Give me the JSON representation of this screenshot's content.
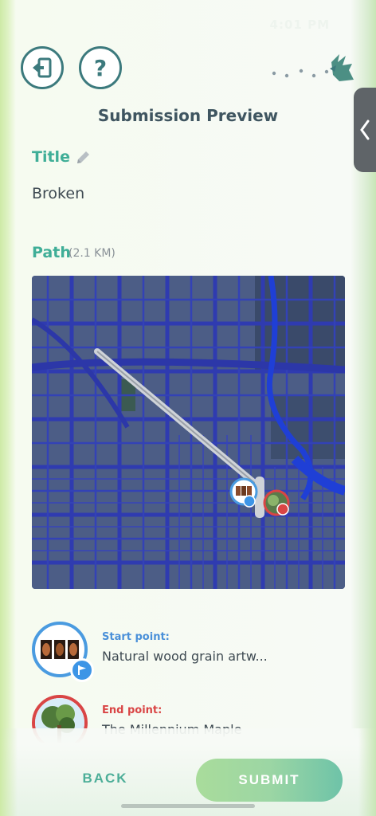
{
  "status": {
    "text": "4:01 PM"
  },
  "header": {
    "title": "Submission Preview"
  },
  "form": {
    "title_label": "Title",
    "title_value": "Broken",
    "path_label": "Path",
    "path_distance": "(2.1 KM)"
  },
  "points": {
    "start": {
      "kind": "Start point:",
      "name": "Natural wood grain artw..."
    },
    "end": {
      "kind": "End point:",
      "name": "The Millennium Maple"
    }
  },
  "actions": {
    "back_label": "BACK",
    "submit_label": "SUBMIT"
  },
  "colors": {
    "accent": "#3fae97",
    "start_color": "#4a9be0",
    "end_color": "#d94545",
    "map_roads": "#2f3b9e",
    "map_blocks": "#4a5b8a"
  },
  "icons": {
    "exit": "exit-door-icon",
    "help": "question-mark-icon",
    "edit": "pencil-icon",
    "collapse": "chevron-left-icon",
    "start_flag": "flag-icon",
    "end_flag": "flag-icon"
  }
}
